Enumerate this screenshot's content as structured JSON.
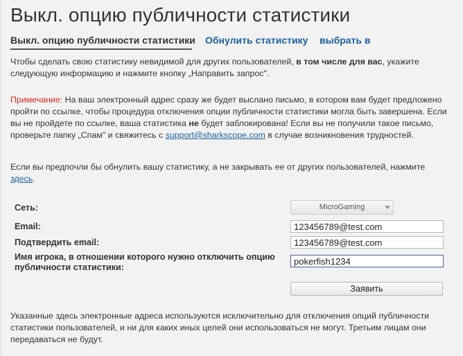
{
  "page_title": "Выкл. опцию публичности статистики",
  "tabs": [
    {
      "label": "Выкл. опцию публичности статистики",
      "active": true
    },
    {
      "label": "Обнулить статистику"
    },
    {
      "label": "выбрать в"
    }
  ],
  "intro": {
    "before": "Чтобы сделать свою статистику невидимой для других пользователей, ",
    "bold": "в том числе для вас",
    "after": ", укажите следующую информацию и нажмите кнопку „Направить запрос\"."
  },
  "note": {
    "label": "Примечание:",
    "text1": " На ваш электронный адрес сразу же будет выслано письмо, в котором вам будет предложено пройти по ссылке, чтобы процедура отключения опции публичности статистики могла быть завершена. Если вы не пройдете по ссылке, ваша статистика ",
    "bold": "не",
    "text2": " будет заблокирована! Если вы не получили такое письмо, проверьте папку „Спам\" и свяжитесь с ",
    "email_link": "support@sharkscope.com",
    "text3": " в случае возникновения трудностей."
  },
  "reset_hint": {
    "text": "Если вы предпочли бы обнулить вашу статистику, а не закрывать ее от других пользователей, нажмите ",
    "link": "здесь",
    "end": "."
  },
  "form": {
    "network_label": "Сеть:",
    "network_value": "MicroGaming",
    "email_label": "Email:",
    "email_value": "123456789@test.com",
    "confirm_label": "Подтвердить email:",
    "confirm_value": "123456789@test.com",
    "player_label": "Имя игрока, в отношении которого нужно отключить опцию публичности статистики:",
    "player_value": "pokerfish1234",
    "submit_label": "Заявить"
  },
  "footer": "Указанные здесь электронные адреса используются исключительно для отключения опций публичности статистики пользователей, и ни для каких иных целей они использоваться не могут. Третьим лицам они передаваться не будут."
}
